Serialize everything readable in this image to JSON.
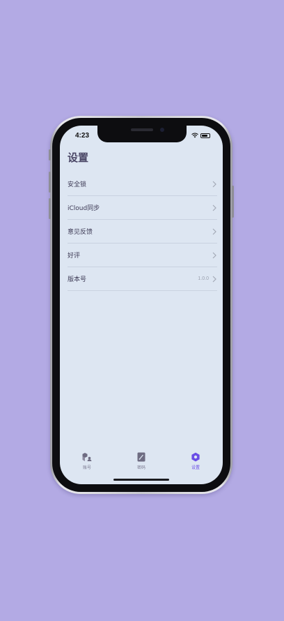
{
  "status_bar": {
    "time": "4:23"
  },
  "page": {
    "title": "设置"
  },
  "settings_rows": [
    {
      "label": "安全锁",
      "value": ""
    },
    {
      "label": "iCloud同步",
      "value": ""
    },
    {
      "label": "意见反馈",
      "value": ""
    },
    {
      "label": "好评",
      "value": ""
    },
    {
      "label": "版本号",
      "value": "1.0.0"
    }
  ],
  "tabs": [
    {
      "label": "账号",
      "icon": "accounts-icon",
      "active": false
    },
    {
      "label": "密码",
      "icon": "password-icon",
      "active": false
    },
    {
      "label": "设置",
      "icon": "gear-icon",
      "active": true
    }
  ],
  "colors": {
    "background": "#b3aae4",
    "screen": "#dde6f2",
    "accent": "#6a4de6",
    "title": "#4b4766"
  }
}
